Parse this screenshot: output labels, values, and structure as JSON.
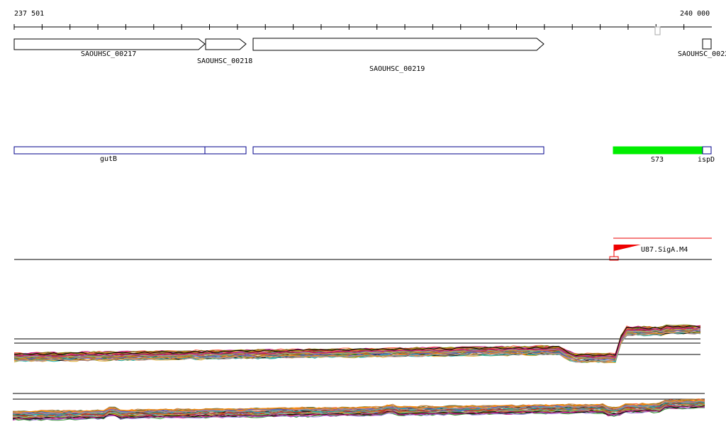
{
  "ruler": {
    "start_label": "237 501",
    "end_label": "240 000"
  },
  "genes": [
    {
      "id": "g217",
      "label": "SAOUHSC_00217",
      "strand": "+"
    },
    {
      "id": "g218",
      "label": "SAOUHSC_00218",
      "strand": "+"
    },
    {
      "id": "g219",
      "label": "SAOUHSC_00219",
      "strand": "+"
    },
    {
      "id": "g220",
      "label": "SAOUHSC_0022",
      "strand": "+"
    }
  ],
  "annotations": [
    {
      "id": "gutB",
      "label": "gutB"
    },
    {
      "id": "s73",
      "label": "S73"
    },
    {
      "id": "ispD",
      "label": "ispD"
    }
  ],
  "motif": {
    "label": "U87.SigA.M4"
  },
  "colors": {
    "gene_stroke": "#000000",
    "annotation_stroke": "#00008b",
    "s73_fill": "#00ee00",
    "motif_red": "#ee0000",
    "axis": "#000000"
  },
  "tracks": {
    "upper_count": 40,
    "lower_count": 40,
    "palette": [
      "#8b4513",
      "#228b22",
      "#b22222",
      "#9370db",
      "#daa520",
      "#2e8b57",
      "#ff6347",
      "#4682b4",
      "#808000",
      "#d2691e",
      "#556b2f",
      "#a52a2a",
      "#6a5acd",
      "#cd853f",
      "#20b2aa",
      "#ff8c00",
      "#8fbc8f",
      "#bc8f8f",
      "#000000",
      "#c71585"
    ]
  }
}
